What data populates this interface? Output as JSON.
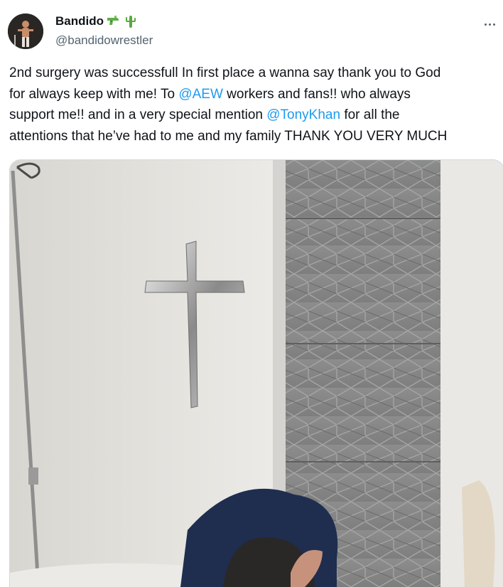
{
  "author": {
    "display_name": "Bandido",
    "handle": "@bandidowrestler",
    "badge_icons": [
      "water-pistol-icon",
      "cactus-icon"
    ]
  },
  "tweet": {
    "line1": "2nd surgery was successfull In first place a wanna say thank you to God",
    "line2_a": "for always keep with me! To ",
    "line2_mention": "@AEW",
    "line2_b": " workers and fans!! who always",
    "line3_a": "support me!! and in a very special mention ",
    "line3_mention": "@TonyKhan",
    "line3_b": " for all the",
    "line4": "attentions that he’ve had to me and my family THANK YOU VERY MUCH"
  },
  "colors": {
    "mention": "#1d9bf0",
    "handle": "#536471",
    "text": "#0f1419"
  }
}
